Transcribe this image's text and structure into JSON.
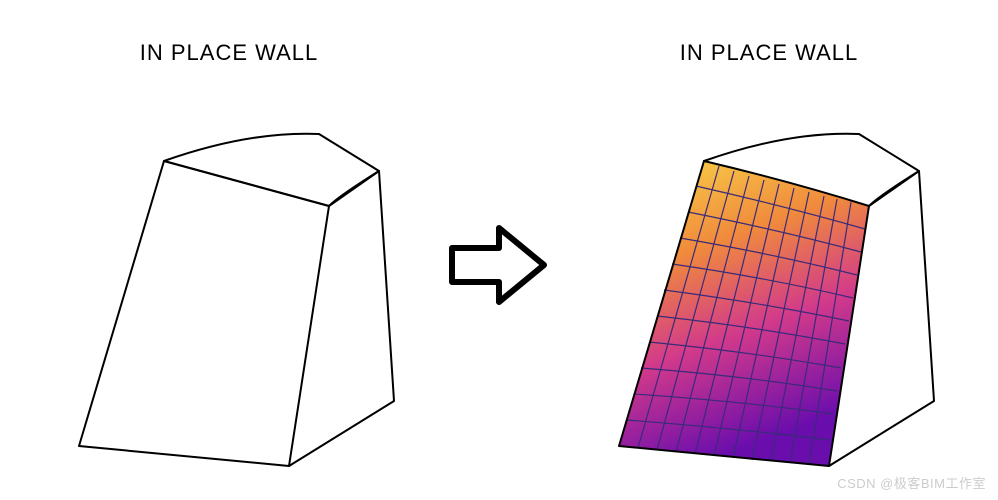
{
  "left": {
    "title": "IN PLACE WALL"
  },
  "right": {
    "title": "IN PLACE WALL"
  },
  "watermark": "CSDN @极客BIM工作室",
  "colors": {
    "gradient_top": "#f9d949",
    "gradient_mid": "#e8684a",
    "gradient_bottom": "#a020b0",
    "gradient_corner": "#6a0dad",
    "grid_line": "#3a2a7a",
    "outline": "#000000"
  }
}
